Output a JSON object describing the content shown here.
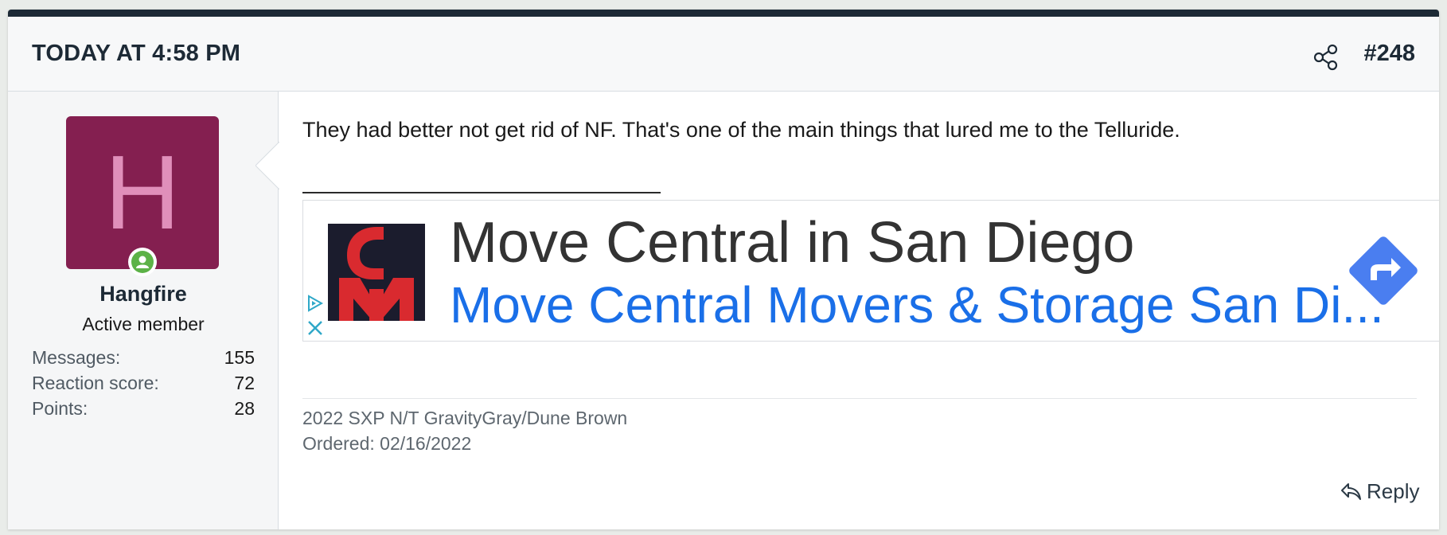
{
  "header": {
    "date": "TODAY AT 4:58 PM",
    "post_number": "#248",
    "share_icon": "share-icon"
  },
  "user": {
    "avatar_letter": "H",
    "avatar_color": "#841f50",
    "online_status_icon": "online-icon",
    "name": "Hangfire",
    "title": "Active member",
    "stats": [
      {
        "label": "Messages:",
        "value": "155"
      },
      {
        "label": "Reaction score:",
        "value": "72"
      },
      {
        "label": "Points:",
        "value": "28"
      }
    ]
  },
  "post": {
    "message": "They had better not get rid of NF. That's one of the main things that lured me to the Telluride.",
    "signature": {
      "line1": "2022 SXP N/T GravityGray/Dune Brown",
      "line2": "Ordered: 02/16/2022"
    },
    "reply_label": "Reply",
    "reply_icon": "reply-icon"
  },
  "ad": {
    "logo_icon": "cm-logo",
    "title": "Move Central in San Diego",
    "subtitle": "Move Central Movers & Storage San Di...",
    "accent": "#1a6fe8",
    "arrow_icon": "directions-icon",
    "choices_icon": "adchoices-icon",
    "close_icon": "close-icon"
  },
  "colors": {
    "header_bar": "#1d2a36",
    "online": "#5cb247",
    "directions": "#4a7ef0"
  }
}
